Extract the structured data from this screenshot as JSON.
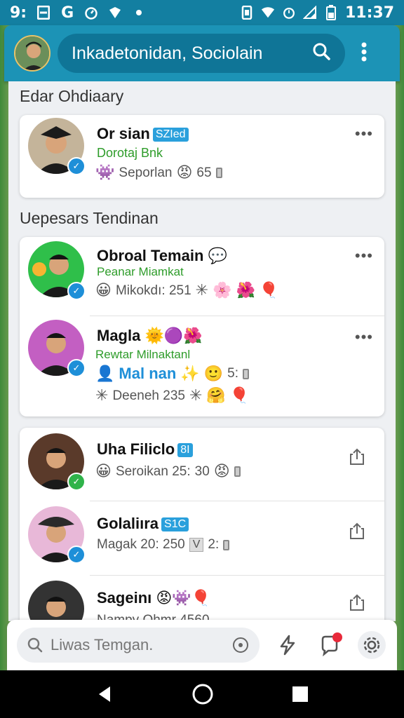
{
  "status": {
    "left": "9:",
    "time": "11:37"
  },
  "header": {
    "search_title": "Inkadetonidan, Sociolain"
  },
  "section1": {
    "title": "Edar Ohdiaary",
    "item": {
      "name": "Or sian",
      "tag": "SZIed",
      "sub": "Dorotaj Bnk",
      "meta": "Seporlan",
      "count": "65"
    }
  },
  "section2": {
    "title": "Uepesars Tendinan",
    "items": [
      {
        "name": "Obroal Temain",
        "sub": "Peanar Miamkat",
        "meta": "Mikokdı: 251"
      },
      {
        "name": "Magla",
        "sub": "Rewtar Milnaktanl",
        "meta_blue": "Mal nan",
        "meta_tail": "5:",
        "meta2": "Deeneh 235"
      }
    ]
  },
  "section3": {
    "items": [
      {
        "name": "Uha Filiclo",
        "tag": "8I",
        "meta": "Seroikan 25:",
        "count": "30"
      },
      {
        "name": "Golaliıra",
        "tag": "S1C",
        "meta": "Magak 20: 250",
        "box": "V",
        "count": "2:"
      },
      {
        "name": "Sageinı",
        "meta": "Nampy Ohmr 4560"
      }
    ]
  },
  "bottom": {
    "search_placeholder": "Liwas Temgan."
  },
  "colors": {
    "accent": "#1c93b6",
    "status_bar": "#137fa1",
    "green_text": "#2e9c2a",
    "tag_blue": "#2aa0dc",
    "notif_red": "#e8293a"
  }
}
